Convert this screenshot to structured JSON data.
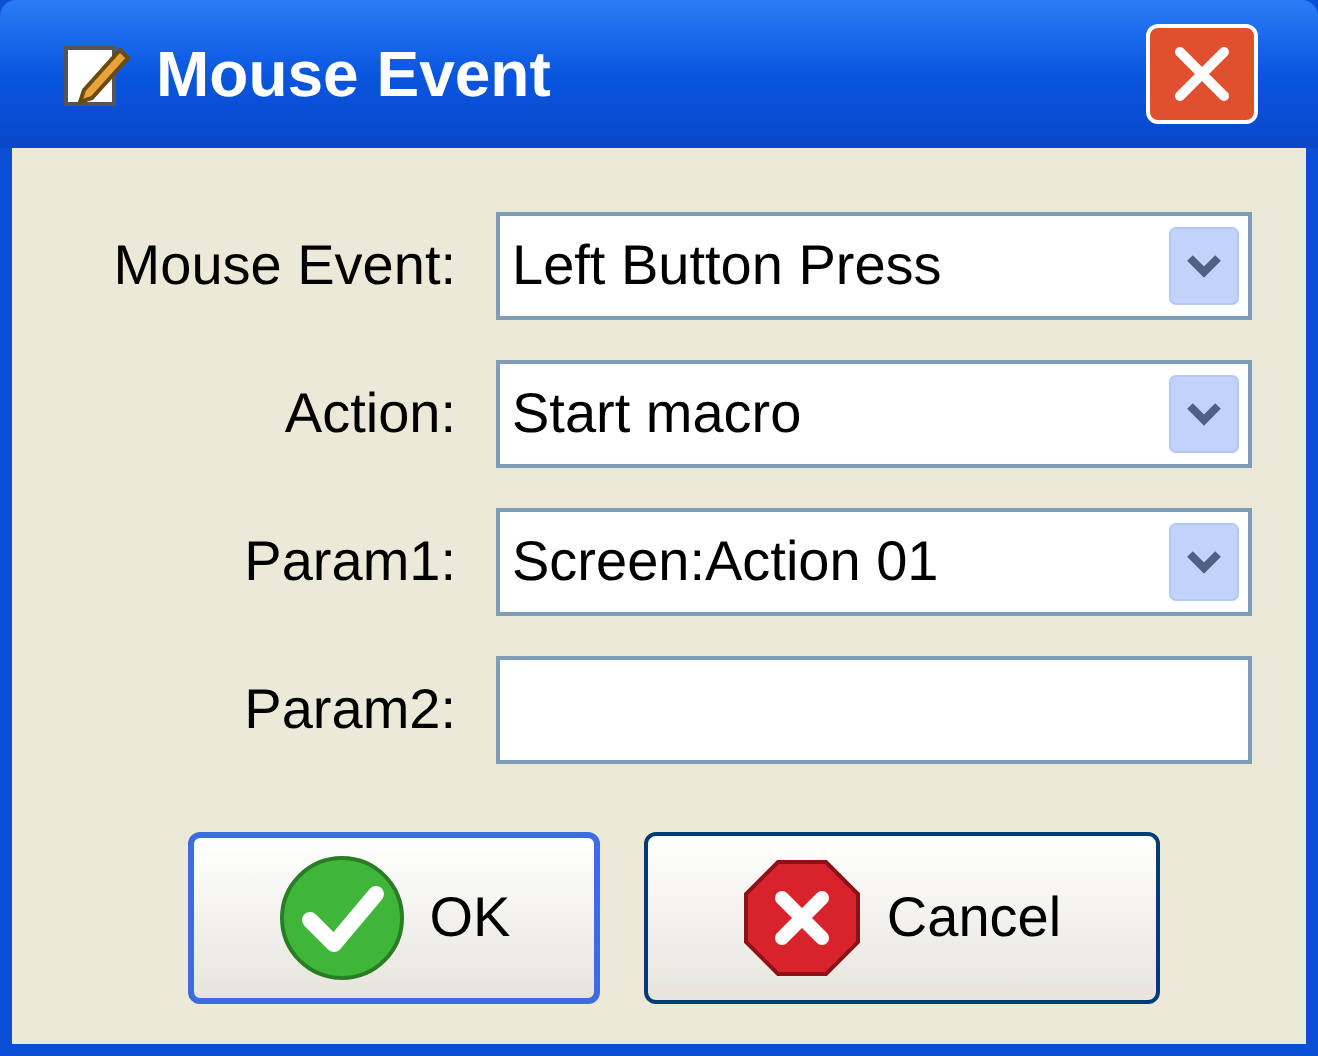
{
  "window": {
    "title": "Mouse Event"
  },
  "fields": [
    {
      "label": "Mouse Event:",
      "kind": "combo",
      "value": "Left Button Press"
    },
    {
      "label": "Action:",
      "kind": "combo",
      "value": "Start macro"
    },
    {
      "label": "Param1:",
      "kind": "combo",
      "value": "Screen:Action 01"
    },
    {
      "label": "Param2:",
      "kind": "text"
    }
  ],
  "buttons": [
    {
      "label": "OK",
      "kind": "ok",
      "focused": true
    },
    {
      "label": "Cancel",
      "kind": "cancel",
      "focused": false
    }
  ]
}
